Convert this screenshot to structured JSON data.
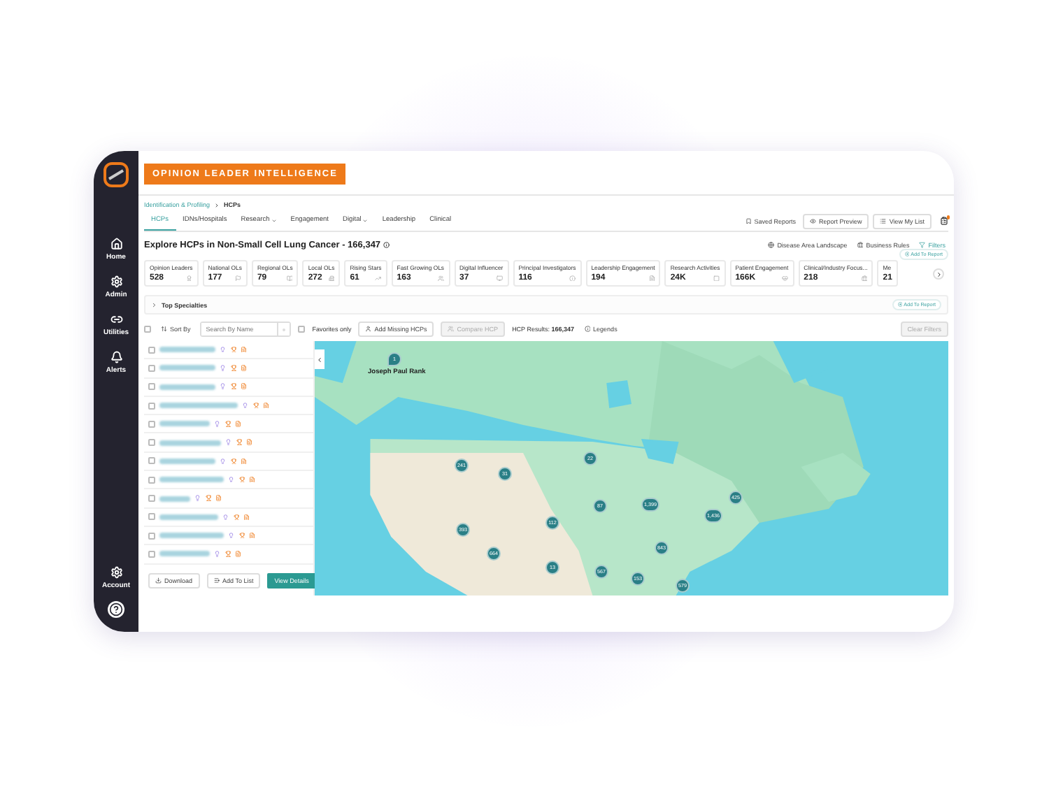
{
  "sidebar": {
    "items": [
      {
        "label": "Home"
      },
      {
        "label": "Admin"
      },
      {
        "label": "Utilities"
      },
      {
        "label": "Alerts"
      }
    ],
    "bottom_items": [
      {
        "label": "Account"
      }
    ]
  },
  "banner": "OPINION LEADER INTELLIGENCE",
  "breadcrumb": [
    {
      "label": "Identification & Profiling",
      "current": false
    },
    {
      "label": "HCPs",
      "current": true
    }
  ],
  "tabs": [
    {
      "label": "HCPs",
      "selected": true,
      "has_menu": false
    },
    {
      "label": "IDNs/Hospitals",
      "selected": false,
      "has_menu": false
    },
    {
      "label": "Research",
      "selected": false,
      "has_menu": true
    },
    {
      "label": "Engagement",
      "selected": false,
      "has_menu": false
    },
    {
      "label": "Digital",
      "selected": false,
      "has_menu": true
    },
    {
      "label": "Leadership",
      "selected": false,
      "has_menu": false
    },
    {
      "label": "Clinical",
      "selected": false,
      "has_menu": false
    }
  ],
  "header_actions": [
    {
      "label": "Saved Reports",
      "kind": "link"
    },
    {
      "label": "Report Preview",
      "kind": "button"
    },
    {
      "label": "View My List",
      "kind": "button"
    }
  ],
  "notification": true,
  "title": "Explore HCPs in Non-Small Cell Lung Cancer - 166,347",
  "title_links": [
    {
      "label": "Disease Area Landscape",
      "kind": "link"
    },
    {
      "label": "Business Rules",
      "kind": "link"
    },
    {
      "label": "Filters",
      "kind": "filter"
    }
  ],
  "metrics_add_to_report": "Add To Report",
  "metrics": [
    {
      "label": "Opinion Leaders",
      "value": "528"
    },
    {
      "label": "National OLs",
      "value": "177"
    },
    {
      "label": "Regional OLs",
      "value": "79"
    },
    {
      "label": "Local OLs",
      "value": "272"
    },
    {
      "label": "Rising Stars",
      "value": "61"
    },
    {
      "label": "Fast Growing OLs",
      "value": "163"
    },
    {
      "label": "Digital Influencer",
      "value": "37"
    },
    {
      "label": "Principal Investigators",
      "value": "116"
    },
    {
      "label": "Leadership Engagement",
      "value": "194"
    },
    {
      "label": "Research Activities",
      "value": "24K"
    },
    {
      "label": "Patient Engagement",
      "value": "166K"
    },
    {
      "label": "Clinical/Industry Focus...",
      "value": "218"
    },
    {
      "label": "Me",
      "value": "21"
    }
  ],
  "top_specialties": {
    "label": "Top Specialties",
    "expanded": false,
    "add_to_report": "Add To Report"
  },
  "toolbar": {
    "select_all": false,
    "sort_label": "Sort By",
    "search_placeholder": "Search By Name",
    "favorites_label": "Favorites only",
    "favorites_checked": false,
    "add_missing": "Add Missing HCPs",
    "compare": "Compare HCP",
    "compare_disabled": true,
    "results_label": "HCP Results:",
    "results_value": "166,347",
    "legends": "Legends",
    "clear_filters": "Clear Filters",
    "clear_disabled": true
  },
  "hcp_list": {
    "rows": [
      {
        "checked": false
      },
      {
        "checked": false
      },
      {
        "checked": false
      },
      {
        "checked": false
      },
      {
        "checked": false
      },
      {
        "checked": false
      },
      {
        "checked": false
      },
      {
        "checked": false
      },
      {
        "checked": false
      },
      {
        "checked": false
      },
      {
        "checked": false
      },
      {
        "checked": false
      }
    ]
  },
  "list_buttons": [
    {
      "label": "Download",
      "primary": false
    },
    {
      "label": "Add To List",
      "primary": false
    },
    {
      "label": "View Details",
      "primary": true
    }
  ],
  "map": {
    "kind": "picture",
    "pin_label": "Joseph Paul Rank",
    "pin_count": "1",
    "markers": [
      {
        "count": "22"
      },
      {
        "count": "241"
      },
      {
        "count": "31"
      },
      {
        "count": "87"
      },
      {
        "count": "1,399"
      },
      {
        "count": "425"
      },
      {
        "count": "1,436"
      },
      {
        "count": "112"
      },
      {
        "count": "393"
      },
      {
        "count": "664"
      },
      {
        "count": "13"
      },
      {
        "count": "843"
      },
      {
        "count": "567"
      },
      {
        "count": "153"
      },
      {
        "count": "579"
      }
    ]
  }
}
